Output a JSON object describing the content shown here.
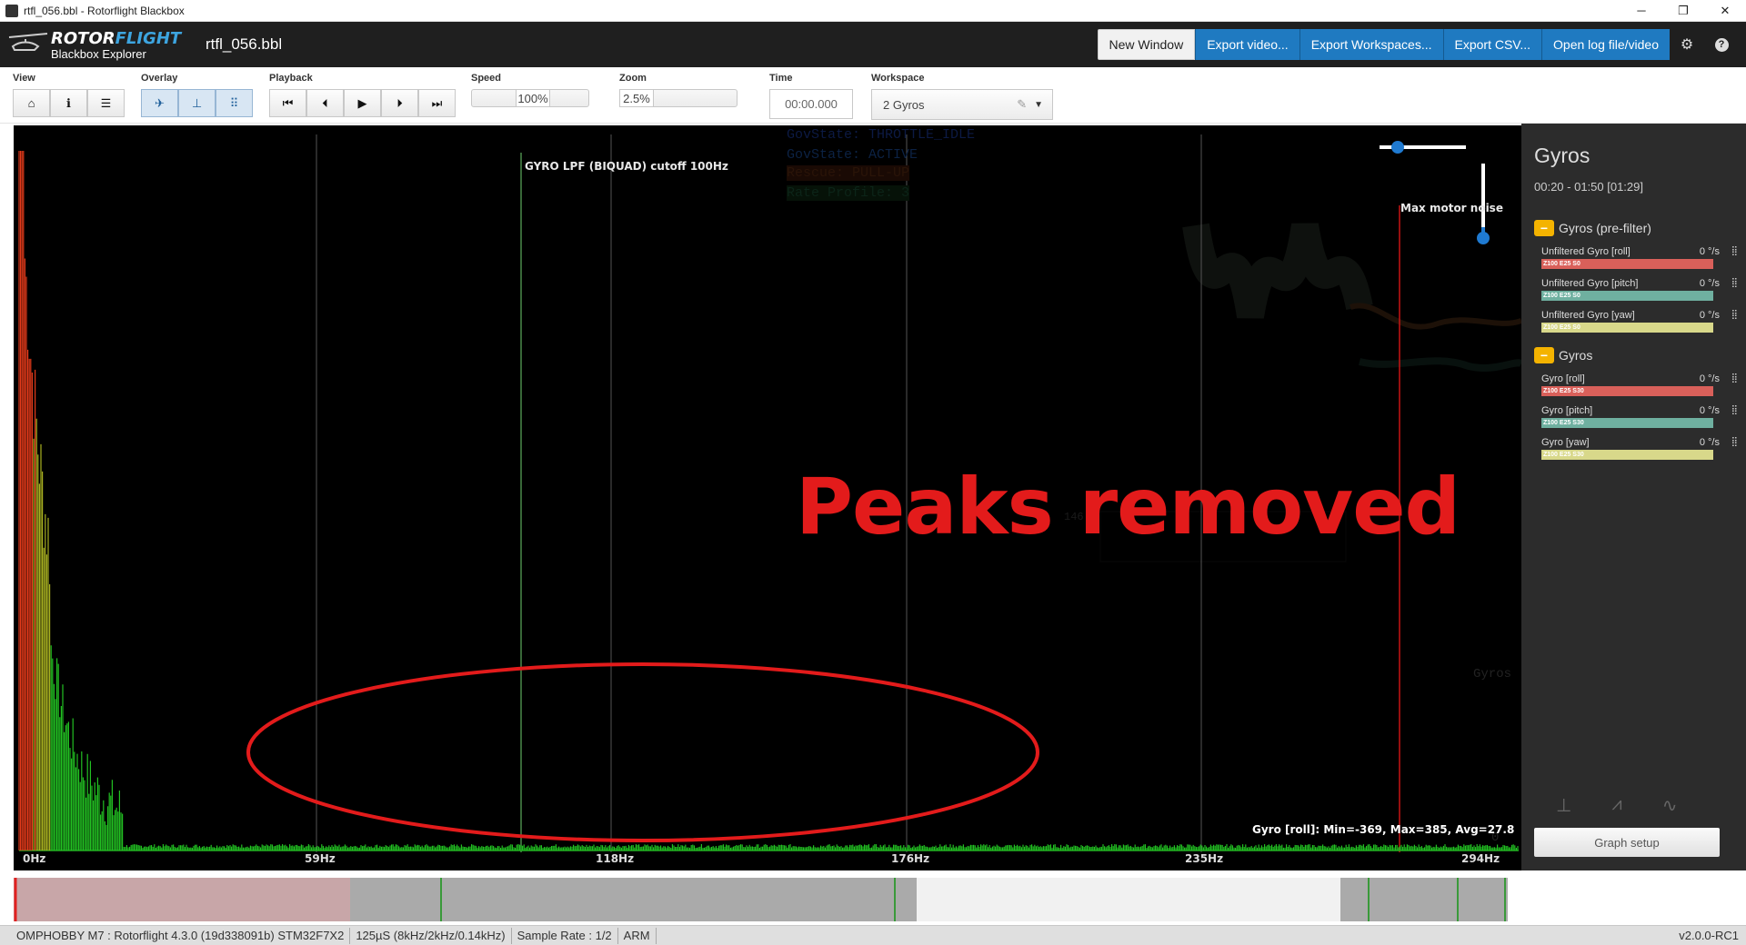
{
  "window": {
    "title": "rtfl_056.bbl - Rotorflight Blackbox",
    "controls": [
      "─",
      "❐",
      "✕"
    ]
  },
  "header": {
    "brand_main": "ROTOR",
    "brand_accent": "FLIGHT",
    "brand_sub": "Blackbox Explorer",
    "filename": "rtfl_056.bbl",
    "buttons": [
      "New Window",
      "Export video...",
      "Export Workspaces...",
      "Export CSV...",
      "Open log file/video"
    ],
    "icons": [
      "gear-icon",
      "help-icon"
    ]
  },
  "toolbar": {
    "view_label": "View",
    "overlay_label": "Overlay",
    "playback_label": "Playback",
    "speed_label": "Speed",
    "speed_value": "100%",
    "zoom_label": "Zoom",
    "zoom_value": "2.5%",
    "time_label": "Time",
    "time_value": "00:00.000",
    "workspace_label": "Workspace",
    "workspace_value": "2 Gyros"
  },
  "plot": {
    "filter_label": "GYRO LPF (BIQUAD) cutoff 100Hz",
    "motor_label": "Max motor noise",
    "x_ticks": [
      "0Hz",
      "59Hz",
      "118Hz",
      "176Hz",
      "235Hz",
      "294Hz"
    ],
    "stats": "Gyro [roll]: Min=-369, Max=385, Avg=27.8",
    "annotation": "Peaks removed",
    "ghost_overlay": [
      "GovState: THROTTLE_IDLE",
      "GovState: ACTIVE",
      "Rescue: PULL-UP",
      "Rate Profile: 3",
      "Gyros",
      "146",
      "0"
    ],
    "colors": {
      "spectrum": "#22cc22",
      "spectrum_peak": "#ff2020",
      "annotation": "#e31b1b",
      "motor_line": "#c81414",
      "filter_line": "#4a8a4a"
    }
  },
  "sidebar": {
    "title": "Gyros",
    "time_range": "00:20 - 01:50 [01:29]",
    "groups": [
      {
        "name": "Gyros (pre-filter)",
        "fields": [
          {
            "name": "Unfiltered Gyro [roll]",
            "value": "0 °/s",
            "tag": "Z100 E25 S0",
            "color": "#d9605a"
          },
          {
            "name": "Unfiltered Gyro [pitch]",
            "value": "0 °/s",
            "tag": "Z100 E25 S0",
            "color": "#6fb0a0"
          },
          {
            "name": "Unfiltered Gyro [yaw]",
            "value": "0 °/s",
            "tag": "Z100 E25 S0",
            "color": "#d8d88a"
          }
        ]
      },
      {
        "name": "Gyros",
        "fields": [
          {
            "name": "Gyro [roll]",
            "value": "0 °/s",
            "tag": "Z100 E25 S30",
            "color": "#d9605a"
          },
          {
            "name": "Gyro [pitch]",
            "value": "0 °/s",
            "tag": "Z100 E25 S30",
            "color": "#6fb0a0"
          },
          {
            "name": "Gyro [yaw]",
            "value": "0 °/s",
            "tag": "Z100 E25 S30",
            "color": "#d8d88a"
          }
        ]
      }
    ],
    "graph_setup": "Graph setup"
  },
  "statusbar": {
    "items": [
      "OMPHOBBY M7 : Rotorflight 4.3.0 (19d338091b) STM32F7X2",
      "125µS (8kHz/2kHz/0.14kHz)",
      "Sample Rate : 1/2",
      "ARM"
    ],
    "version": "v2.0.0-RC1"
  }
}
